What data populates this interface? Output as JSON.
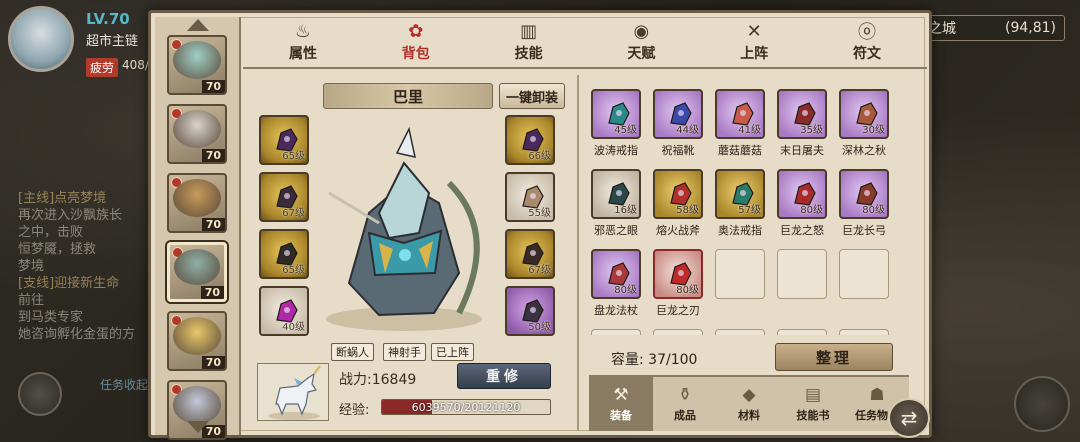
{
  "world": {
    "player": {
      "level": "LV.70",
      "name": "超市主链",
      "fatigue_label": "疲劳",
      "fatigue_value": "408/"
    },
    "location": {
      "name": "金之城",
      "coords": "(94,81)"
    },
    "quests": [
      {
        "head": "[主线]点亮梦境",
        "lines": [
          "再次进入沙飘族长",
          "之中，击败",
          "恒梦魇，拯救",
          "梦境"
        ]
      },
      {
        "head": "[支线]迎接新生命",
        "lines": [
          "前往",
          "到马类专家",
          "她咨询孵化金蛋的方"
        ]
      }
    ],
    "task_collect": "任务收起"
  },
  "heroes": [
    {
      "level": "70",
      "portrait_color": "#9fd0c8"
    },
    {
      "level": "70",
      "portrait_color": "#d9d4cc"
    },
    {
      "level": "70",
      "portrait_color": "#c89a5a"
    },
    {
      "level": "70",
      "portrait_color": "#8fb0a8",
      "selected": true
    },
    {
      "level": "70",
      "portrait_color": "#e8c86a"
    },
    {
      "level": "70",
      "portrait_color": "#c2c8d8"
    }
  ],
  "tabs": [
    {
      "label": "属性",
      "icon": "flame-icon",
      "glyph": "♨"
    },
    {
      "label": "背包",
      "icon": "bag-icon",
      "glyph": "✿",
      "active": true
    },
    {
      "label": "技能",
      "icon": "book-icon",
      "glyph": "▥"
    },
    {
      "label": "天赋",
      "icon": "eye-icon",
      "glyph": "◉"
    },
    {
      "label": "上阵",
      "icon": "crossed-swords-icon",
      "glyph": "✕"
    },
    {
      "label": "符文",
      "icon": "rune-icon",
      "glyph": "ⓞ"
    }
  ],
  "hero": {
    "name": "巴里",
    "unequip_label": "一键卸装",
    "tags": [
      "断蜗人",
      "神射手",
      "已上阵"
    ],
    "power_label": "战力:16849",
    "rebuild_label": "重修",
    "exp_label": "经验:",
    "exp_text": "6039570/20121120",
    "exp_fraction": 0.3,
    "left_slots": [
      {
        "rarity": "gold",
        "level": "65级",
        "color": "#4a2a5a"
      },
      {
        "rarity": "gold",
        "level": "67级",
        "color": "#3a2a3a"
      },
      {
        "rarity": "gold",
        "level": "65级",
        "color": "#2e2a26"
      },
      {
        "rarity": "white",
        "level": "40级",
        "color": "#b02aa8"
      }
    ],
    "right_slots": [
      {
        "rarity": "gold",
        "level": "66级",
        "color": "#4a2a5a"
      },
      {
        "rarity": "white",
        "level": "55级",
        "color": "#a88a6a"
      },
      {
        "rarity": "gold",
        "level": "67级",
        "color": "#3a2a26"
      },
      {
        "rarity": "purple",
        "level": "50级",
        "color": "#3a3240"
      }
    ]
  },
  "inventory": {
    "items": [
      {
        "name": "波涛戒指",
        "level": "45级",
        "rarity": "purple",
        "color": "#2a8a8a"
      },
      {
        "name": "祝福靴",
        "level": "44级",
        "rarity": "purple",
        "color": "#3a4aa8"
      },
      {
        "name": "蘑菇蘑菇",
        "level": "41级",
        "rarity": "purple",
        "color": "#c85a4a"
      },
      {
        "name": "末日屠夫",
        "level": "35级",
        "rarity": "purple",
        "color": "#8a2a2a"
      },
      {
        "name": "深林之秋",
        "level": "30级",
        "rarity": "purple",
        "color": "#a85a3a"
      },
      {
        "name": "邪恶之眼",
        "level": "16级",
        "rarity": "white",
        "color": "#2a4a4a"
      },
      {
        "name": "熔火战斧",
        "level": "58级",
        "rarity": "gold",
        "color": "#b0302a"
      },
      {
        "name": "奥法戒指",
        "level": "57级",
        "rarity": "gold",
        "color": "#2a7a6a"
      },
      {
        "name": "巨龙之怒",
        "level": "80级",
        "rarity": "purple",
        "color": "#a82a2a"
      },
      {
        "name": "巨龙长弓",
        "level": "80级",
        "rarity": "purple",
        "color": "#8a3a2a"
      },
      {
        "name": "盘龙法杖",
        "level": "80级",
        "rarity": "purple",
        "color": "#a83a3a"
      },
      {
        "name": "巨龙之刃",
        "level": "80级",
        "rarity": "red",
        "color": "#c02a2a"
      },
      {
        "name": "",
        "level": "",
        "rarity": "empty"
      },
      {
        "name": "",
        "level": "",
        "rarity": "empty"
      },
      {
        "name": "",
        "level": "",
        "rarity": "empty"
      },
      {
        "name": "",
        "level": "",
        "rarity": "empty"
      },
      {
        "name": "",
        "level": "",
        "rarity": "empty"
      },
      {
        "name": "",
        "level": "",
        "rarity": "empty"
      },
      {
        "name": "",
        "level": "",
        "rarity": "empty"
      },
      {
        "name": "",
        "level": "",
        "rarity": "empty"
      }
    ],
    "capacity_label": "容量:",
    "capacity_value": "37/100",
    "tidy_label": "整理",
    "categories": [
      {
        "label": "装备",
        "icon": "hammer-icon",
        "glyph": "⚒",
        "active": true
      },
      {
        "label": "成品",
        "icon": "potion-bag-icon",
        "glyph": "⚱"
      },
      {
        "label": "材料",
        "icon": "ore-icon",
        "glyph": "◆"
      },
      {
        "label": "技能书",
        "icon": "scroll-icon",
        "glyph": "▤"
      },
      {
        "label": "任务物品",
        "icon": "pouch-icon",
        "glyph": "☗"
      }
    ]
  },
  "swap_icon": "⇄"
}
